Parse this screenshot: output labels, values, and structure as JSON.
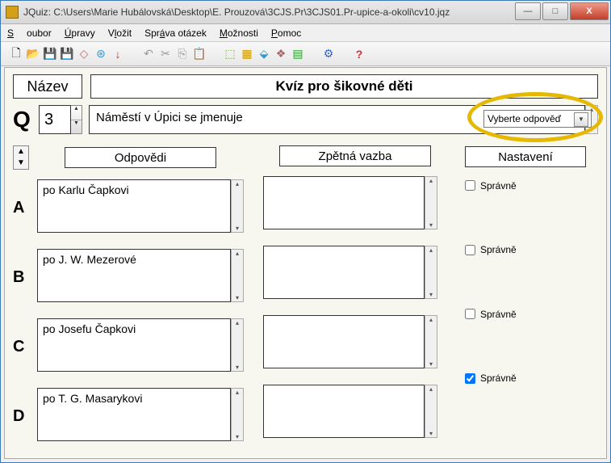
{
  "window": {
    "title": "JQuiz: C:\\Users\\Marie Hubálovská\\Desktop\\E. Prouzová\\3CJS.Pr\\3CJS01.Pr-upice-a-okoli\\cv10.jqz"
  },
  "menu": {
    "soubor": "Soubor",
    "upravy": "Úpravy",
    "vlozit": "Vložit",
    "sprava": "Správa otázek",
    "moznosti": "Možnosti",
    "pomoc": "Pomoc"
  },
  "header": {
    "nazev_label": "Název",
    "title": "Kvíz pro šikovné děti",
    "q_label": "Q",
    "q_number": "3",
    "question_text": "Náměstí v Úpici se jmenuje",
    "dropdown": "Vyberte odpověď"
  },
  "columns": {
    "answers": "Odpovědi",
    "feedback": "Zpětná vazba",
    "settings": "Nastavení"
  },
  "correct_label": "Správně",
  "answers": [
    {
      "letter": "A",
      "text": "po Karlu Čapkovi",
      "feedback": "",
      "correct": false
    },
    {
      "letter": "B",
      "text": "po J. W. Mezerové",
      "feedback": "",
      "correct": false
    },
    {
      "letter": "C",
      "text": "po Josefu Čapkovi",
      "feedback": "",
      "correct": false
    },
    {
      "letter": "D",
      "text": "po T. G. Masarykovi",
      "feedback": "",
      "correct": true
    }
  ]
}
